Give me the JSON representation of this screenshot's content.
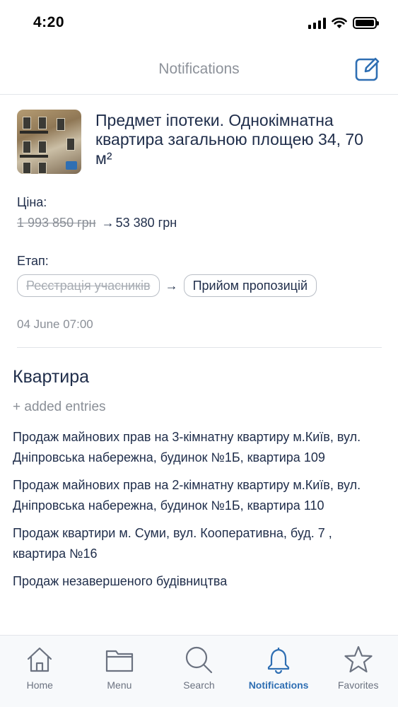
{
  "status_bar": {
    "time": "4:20"
  },
  "header": {
    "title": "Notifications",
    "compose_icon": "edit-icon"
  },
  "notification": {
    "title": "Предмет іпотеки. Однокімнатна квартира загальною площею 34, 70 м²",
    "price_label": "Ціна:",
    "old_price": "1 993 850 грн",
    "new_price": "53 380 грн",
    "arrow": "→",
    "stage_label": "Етап:",
    "old_stage": "Реєстрація учасників",
    "new_stage": "Прийом пропозицій",
    "date": "04 June 07:00"
  },
  "section": {
    "title": "Квартира",
    "added_label": "+ added entries",
    "entries": [
      "Продаж майнових прав на 3-кімнатну квартиру м.Київ, вул. Дніпровська набережна, будинок №1Б, квартира 109",
      "Продаж майнових прав на 2-кімнатну квартиру м.Київ, вул. Дніпровська набережна, будинок №1Б, квартира 110",
      "Продаж квартири м. Суми, вул. Кооперативна, буд. 7 , квартира №16",
      "Продаж незавершеного будівництва"
    ]
  },
  "tabs": [
    {
      "label": "Home",
      "icon": "home-icon",
      "active": false
    },
    {
      "label": "Menu",
      "icon": "folder-icon",
      "active": false
    },
    {
      "label": "Search",
      "icon": "search-icon",
      "active": false
    },
    {
      "label": "Notifications",
      "icon": "bell-icon",
      "active": true
    },
    {
      "label": "Favorites",
      "icon": "star-icon",
      "active": false
    }
  ],
  "colors": {
    "accent": "#2f6fb3",
    "text": "#1f2d4a",
    "muted": "#8a8f97"
  }
}
